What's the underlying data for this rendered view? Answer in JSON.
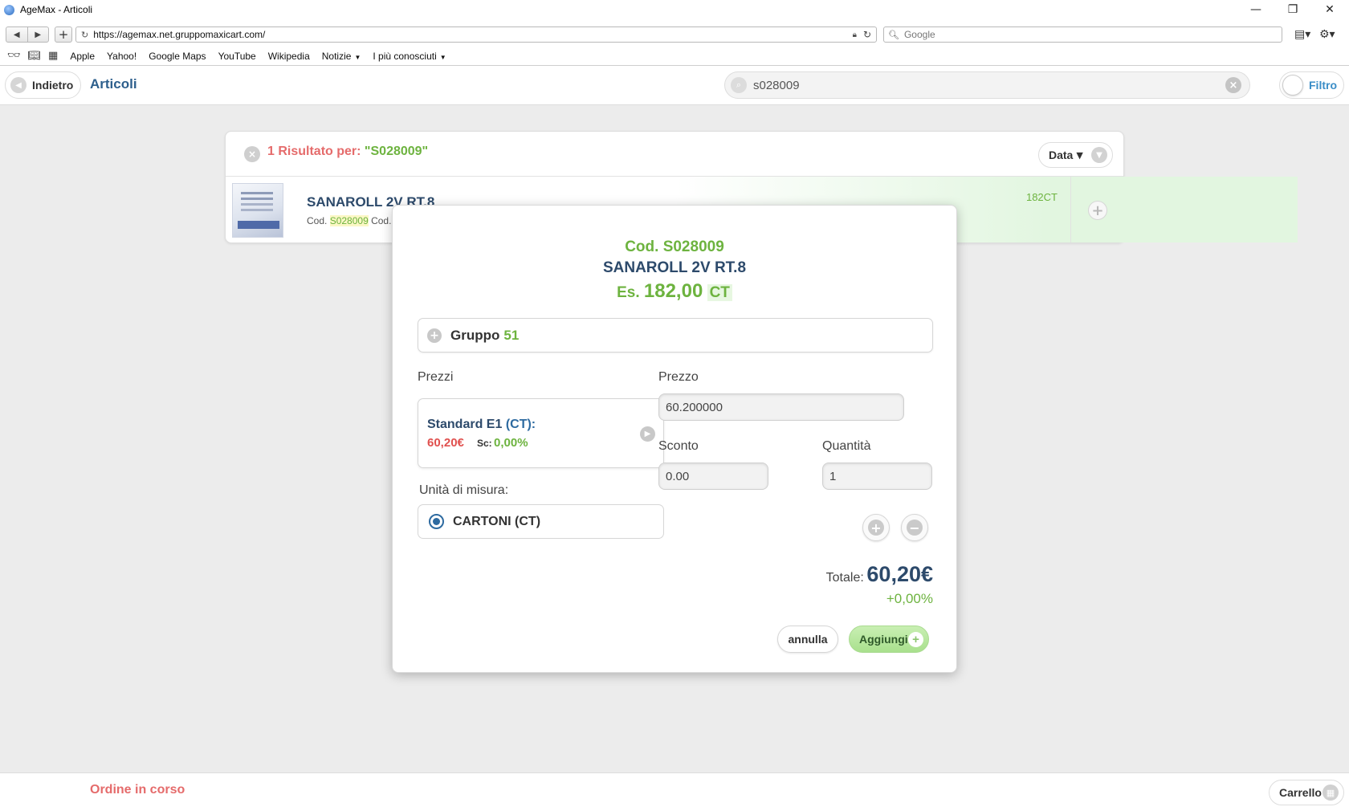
{
  "window": {
    "title": "AgeMax - Articoli",
    "controls": [
      "—",
      "❐",
      "✕"
    ]
  },
  "browser": {
    "url": "https://agemax.net.gruppomaxicart.com/",
    "search_placeholder": "Google",
    "bookmarks": [
      {
        "label": "Apple",
        "menu": false
      },
      {
        "label": "Yahoo!",
        "menu": false
      },
      {
        "label": "Google Maps",
        "menu": false
      },
      {
        "label": "YouTube",
        "menu": false
      },
      {
        "label": "Wikipedia",
        "menu": false
      },
      {
        "label": "Notizie",
        "menu": true
      },
      {
        "label": "I più conosciuti",
        "menu": true
      }
    ]
  },
  "header": {
    "back_label": "Indietro",
    "page_title": "Articoli",
    "search_value": "s028009",
    "filter_label": "Filtro"
  },
  "results": {
    "title_prefix": "1 Risultato per: ",
    "title_query": "\"S028009\"",
    "sort_label": "Data",
    "item": {
      "name": "SANAROLL 2V RT.8",
      "code_label": "Cod.",
      "code_value": "S028009",
      "code_suffix": "Cod.F",
      "qty": "182CT"
    }
  },
  "modal": {
    "code_line": "Cod. S028009",
    "name": "SANAROLL 2V RT.8",
    "stock_prefix": "Es.",
    "stock_value": "182,00",
    "stock_unit": "CT",
    "group_label": "Gruppo",
    "group_value": "51",
    "prices_label": "Prezzi",
    "price_card": {
      "name": "Standard E1",
      "unit": "(CT):",
      "value": "60,20€",
      "discount_label": "Sc:",
      "discount_value": "0,00%"
    },
    "unit_label": "Unità di misura:",
    "unit_option": "CARTONI (CT)",
    "prezzo_label": "Prezzo",
    "prezzo_value": "60.200000",
    "sconto_label": "Sconto",
    "sconto_value": "0.00",
    "quantita_label": "Quantità",
    "quantita_value": "1",
    "total_label": "Totale:",
    "total_value": "60,20€",
    "total_discount": "+0,00%",
    "cancel_label": "annulla",
    "add_label": "Aggiungi"
  },
  "footer": {
    "order_label": "Ordine in corso",
    "cart_label": "Carrello"
  },
  "colors": {
    "accent_blue": "#2d4a6b",
    "green": "#6db33f",
    "red": "#e56b6b",
    "link_blue": "#3a8dc7"
  }
}
